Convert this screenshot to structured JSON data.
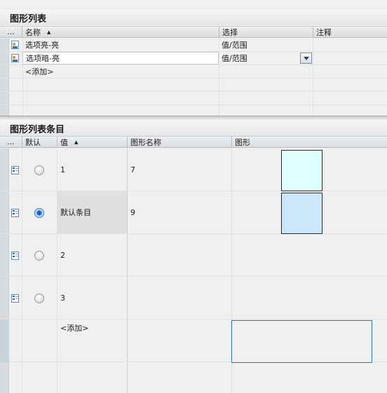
{
  "graphic_list": {
    "title": "图形列表",
    "columns": {
      "dots": "...",
      "name": "名称",
      "select": "选择",
      "comment": "注释"
    },
    "rows": [
      {
        "name": "选项亮-亮",
        "select": "值/范围",
        "comment": ""
      },
      {
        "name": "选项暗-亮",
        "select": "值/范围",
        "comment": ""
      }
    ],
    "add_label": "<添加>"
  },
  "graphic_list_entries": {
    "title": "图形列表条目",
    "columns": {
      "dots": "...",
      "default": "默认",
      "value": "值",
      "graphic_name": "图形名称",
      "graphic": "图形"
    },
    "rows": [
      {
        "default": false,
        "value": "1",
        "graphic_name": "7",
        "swatch_color": "#e0ffff"
      },
      {
        "default": true,
        "value": "默认条目",
        "graphic_name": "9",
        "swatch_color": "#cce6fa"
      },
      {
        "default": false,
        "value": "2",
        "graphic_name": "",
        "swatch_color": ""
      },
      {
        "default": false,
        "value": "3",
        "graphic_name": "",
        "swatch_color": ""
      }
    ],
    "add_label": "<添加>"
  },
  "colors": {
    "selection_border": "#3a6fb0",
    "header_bg": "#dde1e5"
  }
}
